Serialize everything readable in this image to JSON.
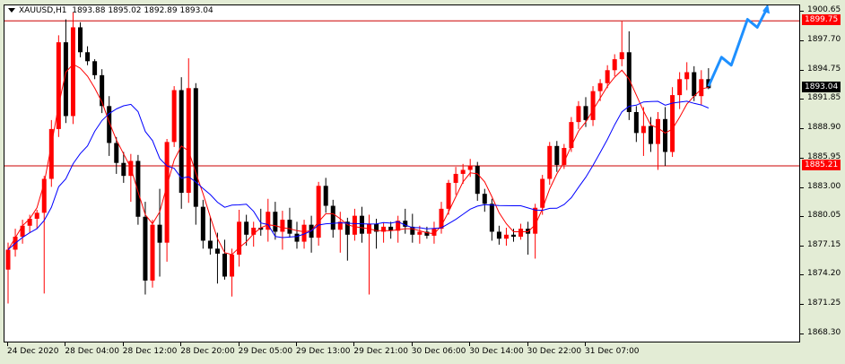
{
  "header": {
    "symbol": "XAUUSD,H1",
    "ohlc": "1893.88 1895.02 1892.89 1893.04"
  },
  "colors": {
    "bull": "#ff0000",
    "bear": "#000000",
    "ma_fast": "#ff0000",
    "ma_slow": "#0000ff",
    "forecast": "#1e90ff",
    "level_line": "#cc0000",
    "tag_level_bg": "#ff0000",
    "tag_price_bg": "#000000"
  },
  "price_tags": {
    "level_upper": "1899.75",
    "level_lower": "1885.21",
    "current": "1893.04"
  },
  "chart_data": {
    "type": "candlestick",
    "title": "XAUUSD,H1",
    "ylim": [
      1868.3,
      1901.3
    ],
    "yticks": [
      "1900.65",
      "1897.70",
      "1894.75",
      "1891.85",
      "1888.90",
      "1885.95",
      "1883.00",
      "1880.05",
      "1877.15",
      "1874.20",
      "1871.25",
      "1868.30"
    ],
    "xticks": [
      {
        "i": 0,
        "label": "24 Dec 2020"
      },
      {
        "i": 8,
        "label": "28 Dec 04:00"
      },
      {
        "i": 16,
        "label": "28 Dec 12:00"
      },
      {
        "i": 24,
        "label": "28 Dec 20:00"
      },
      {
        "i": 32,
        "label": "29 Dec 05:00"
      },
      {
        "i": 40,
        "label": "29 Dec 13:00"
      },
      {
        "i": 48,
        "label": "29 Dec 21:00"
      },
      {
        "i": 56,
        "label": "30 Dec 06:00"
      },
      {
        "i": 64,
        "label": "30 Dec 14:00"
      },
      {
        "i": 72,
        "label": "30 Dec 22:00"
      },
      {
        "i": 80,
        "label": "31 Dec 07:00"
      }
    ],
    "candles": [
      [
        1874.8,
        1877.5,
        1871.4,
        1876.8
      ],
      [
        1876.8,
        1878.9,
        1876.1,
        1878.1
      ],
      [
        1878.1,
        1879.8,
        1877.4,
        1879.2
      ],
      [
        1879.2,
        1880.3,
        1878.5,
        1879.9
      ],
      [
        1879.9,
        1880.8,
        1878.9,
        1880.5
      ],
      [
        1880.5,
        1884.2,
        1872.4,
        1883.9
      ],
      [
        1883.9,
        1889.8,
        1883.1,
        1888.9
      ],
      [
        1888.9,
        1898.3,
        1888.1,
        1897.6
      ],
      [
        1897.6,
        1899.9,
        1889.5,
        1890.2
      ],
      [
        1890.2,
        1900.6,
        1889.4,
        1899.1
      ],
      [
        1899.1,
        1899.6,
        1896.1,
        1896.6
      ],
      [
        1896.6,
        1897.2,
        1895.3,
        1895.7
      ],
      [
        1895.7,
        1895.9,
        1893.9,
        1894.3
      ],
      [
        1894.3,
        1894.9,
        1890.5,
        1891.2
      ],
      [
        1891.2,
        1892.2,
        1886.2,
        1887.5
      ],
      [
        1887.5,
        1888.1,
        1884.4,
        1885.5
      ],
      [
        1885.5,
        1886.6,
        1883.5,
        1884.2
      ],
      [
        1884.2,
        1886.4,
        1881.6,
        1885.7
      ],
      [
        1885.7,
        1886.3,
        1879.3,
        1880.1
      ],
      [
        1880.1,
        1881.6,
        1872.3,
        1873.7
      ],
      [
        1873.7,
        1879.8,
        1873.0,
        1879.3
      ],
      [
        1879.3,
        1882.9,
        1874.1,
        1877.5
      ],
      [
        1877.5,
        1887.9,
        1875.6,
        1887.6
      ],
      [
        1887.6,
        1893.2,
        1887.1,
        1892.8
      ],
      [
        1892.8,
        1894.1,
        1880.9,
        1882.5
      ],
      [
        1882.5,
        1896.0,
        1881.5,
        1893.0
      ],
      [
        1893.0,
        1893.5,
        1879.3,
        1881.1
      ],
      [
        1881.1,
        1881.8,
        1876.9,
        1877.7
      ],
      [
        1877.7,
        1880.1,
        1876.3,
        1876.9
      ],
      [
        1876.9,
        1878.5,
        1873.4,
        1876.4
      ],
      [
        1876.4,
        1877.8,
        1873.8,
        1874.1
      ],
      [
        1874.1,
        1876.9,
        1872.1,
        1876.3
      ],
      [
        1876.3,
        1880.8,
        1875.1,
        1879.6
      ],
      [
        1879.6,
        1880.3,
        1877.2,
        1878.3
      ],
      [
        1878.3,
        1879.6,
        1877.1,
        1879.0
      ],
      [
        1879.0,
        1880.9,
        1878.2,
        1878.8
      ],
      [
        1878.8,
        1881.9,
        1877.6,
        1880.6
      ],
      [
        1880.6,
        1881.6,
        1877.8,
        1878.6
      ],
      [
        1878.6,
        1880.7,
        1876.8,
        1879.8
      ],
      [
        1879.8,
        1881.0,
        1878.0,
        1878.4
      ],
      [
        1878.4,
        1879.6,
        1876.9,
        1877.6
      ],
      [
        1877.6,
        1879.8,
        1876.9,
        1879.3
      ],
      [
        1879.3,
        1880.2,
        1876.5,
        1878.0
      ],
      [
        1878.0,
        1883.6,
        1877.2,
        1883.2
      ],
      [
        1883.2,
        1884.0,
        1880.5,
        1881.2
      ],
      [
        1881.2,
        1881.8,
        1878.0,
        1878.8
      ],
      [
        1878.8,
        1880.6,
        1876.5,
        1879.6
      ],
      [
        1879.6,
        1880.0,
        1875.7,
        1878.3
      ],
      [
        1878.3,
        1880.9,
        1877.7,
        1880.2
      ],
      [
        1880.2,
        1881.1,
        1877.5,
        1878.4
      ],
      [
        1878.4,
        1880.3,
        1872.3,
        1879.4
      ],
      [
        1879.4,
        1879.9,
        1876.9,
        1878.6
      ],
      [
        1878.6,
        1879.5,
        1877.5,
        1879.1
      ],
      [
        1879.1,
        1879.6,
        1877.9,
        1878.7
      ],
      [
        1878.7,
        1880.2,
        1877.5,
        1879.7
      ],
      [
        1879.7,
        1880.9,
        1878.4,
        1879.1
      ],
      [
        1879.1,
        1880.4,
        1877.5,
        1878.3
      ],
      [
        1878.3,
        1879.2,
        1877.4,
        1878.6
      ],
      [
        1878.6,
        1879.1,
        1877.9,
        1878.2
      ],
      [
        1878.2,
        1879.6,
        1877.4,
        1878.9
      ],
      [
        1878.9,
        1881.6,
        1878.4,
        1880.9
      ],
      [
        1880.9,
        1883.8,
        1880.3,
        1883.5
      ],
      [
        1883.5,
        1885.1,
        1882.3,
        1884.4
      ],
      [
        1884.4,
        1885.4,
        1883.4,
        1884.8
      ],
      [
        1884.8,
        1885.9,
        1884.1,
        1885.2
      ],
      [
        1885.2,
        1885.6,
        1881.7,
        1882.4
      ],
      [
        1882.4,
        1882.9,
        1880.6,
        1881.4
      ],
      [
        1881.4,
        1881.9,
        1877.7,
        1878.6
      ],
      [
        1878.6,
        1879.2,
        1877.3,
        1877.9
      ],
      [
        1877.9,
        1879.0,
        1877.2,
        1878.3
      ],
      [
        1878.3,
        1878.9,
        1877.6,
        1878.1
      ],
      [
        1878.1,
        1879.4,
        1877.8,
        1878.9
      ],
      [
        1878.9,
        1879.6,
        1876.3,
        1878.4
      ],
      [
        1878.4,
        1881.4,
        1875.9,
        1881.0
      ],
      [
        1881.0,
        1884.3,
        1880.3,
        1883.9
      ],
      [
        1883.9,
        1887.6,
        1883.3,
        1887.2
      ],
      [
        1887.2,
        1887.7,
        1884.6,
        1885.3
      ],
      [
        1885.3,
        1887.4,
        1884.9,
        1887.0
      ],
      [
        1887.0,
        1890.1,
        1886.6,
        1889.6
      ],
      [
        1889.6,
        1891.7,
        1888.9,
        1891.2
      ],
      [
        1891.2,
        1892.1,
        1889.1,
        1889.8
      ],
      [
        1889.8,
        1893.2,
        1889.2,
        1892.7
      ],
      [
        1892.7,
        1893.9,
        1891.7,
        1893.5
      ],
      [
        1893.5,
        1895.3,
        1893.0,
        1894.8
      ],
      [
        1894.8,
        1896.4,
        1894.2,
        1895.9
      ],
      [
        1895.9,
        1899.7,
        1895.2,
        1896.6
      ],
      [
        1896.6,
        1898.7,
        1889.8,
        1890.6
      ],
      [
        1890.6,
        1891.2,
        1887.6,
        1888.5
      ],
      [
        1888.5,
        1891.1,
        1886.2,
        1889.2
      ],
      [
        1889.2,
        1890.1,
        1886.6,
        1887.4
      ],
      [
        1887.4,
        1890.6,
        1884.8,
        1889.9
      ],
      [
        1889.9,
        1891.1,
        1885.2,
        1886.6
      ],
      [
        1886.6,
        1893.1,
        1886.1,
        1892.3
      ],
      [
        1892.3,
        1894.6,
        1890.9,
        1893.9
      ],
      [
        1893.9,
        1895.6,
        1892.8,
        1894.6
      ],
      [
        1894.6,
        1895.2,
        1891.7,
        1892.2
      ],
      [
        1892.2,
        1894.8,
        1891.3,
        1893.9
      ],
      [
        1893.9,
        1895.0,
        1892.9,
        1893.0
      ]
    ],
    "ma_fast": [
      1876.8,
      1878.0,
      1879.2,
      1879.9,
      1881.0,
      1883.5,
      1887.3,
      1891.3,
      1894.6,
      1895.4,
      1895.0,
      1894.2,
      1893.0,
      1891.6,
      1889.6,
      1887.8,
      1886.4,
      1885.0,
      1882.6,
      1880.3,
      1879.4,
      1880.6,
      1883.2,
      1885.8,
      1887.2,
      1886.7,
      1884.5,
      1882.4,
      1880.1,
      1877.9,
      1876.5,
      1876.3,
      1877.0,
      1877.6,
      1878.4,
      1879.0,
      1879.3,
      1879.2,
      1879.0,
      1878.9,
      1878.7,
      1878.6,
      1878.7,
      1879.6,
      1880.4,
      1880.4,
      1879.9,
      1879.3,
      1879.1,
      1879.0,
      1878.9,
      1878.7,
      1878.7,
      1878.7,
      1878.8,
      1878.9,
      1878.9,
      1878.7,
      1878.5,
      1878.4,
      1879.2,
      1880.6,
      1882.1,
      1883.6,
      1884.5,
      1884.4,
      1883.6,
      1882.1,
      1880.5,
      1879.4,
      1878.6,
      1878.6,
      1878.6,
      1879.3,
      1880.9,
      1882.9,
      1884.4,
      1885.6,
      1887.2,
      1888.7,
      1889.6,
      1890.8,
      1892.0,
      1893.2,
      1894.1,
      1894.8,
      1893.9,
      1892.3,
      1890.7,
      1889.3,
      1889.0,
      1888.5,
      1888.9,
      1890.1,
      1891.4,
      1892.2,
      1892.9,
      1893.1
    ]
  },
  "forecast_arrow": [
    [
      1893.2,
      0
    ],
    [
      1896.1,
      4
    ],
    [
      1895.3,
      7
    ],
    [
      1899.9,
      12
    ],
    [
      1899.1,
      15
    ],
    [
      1901.0,
      18
    ]
  ]
}
